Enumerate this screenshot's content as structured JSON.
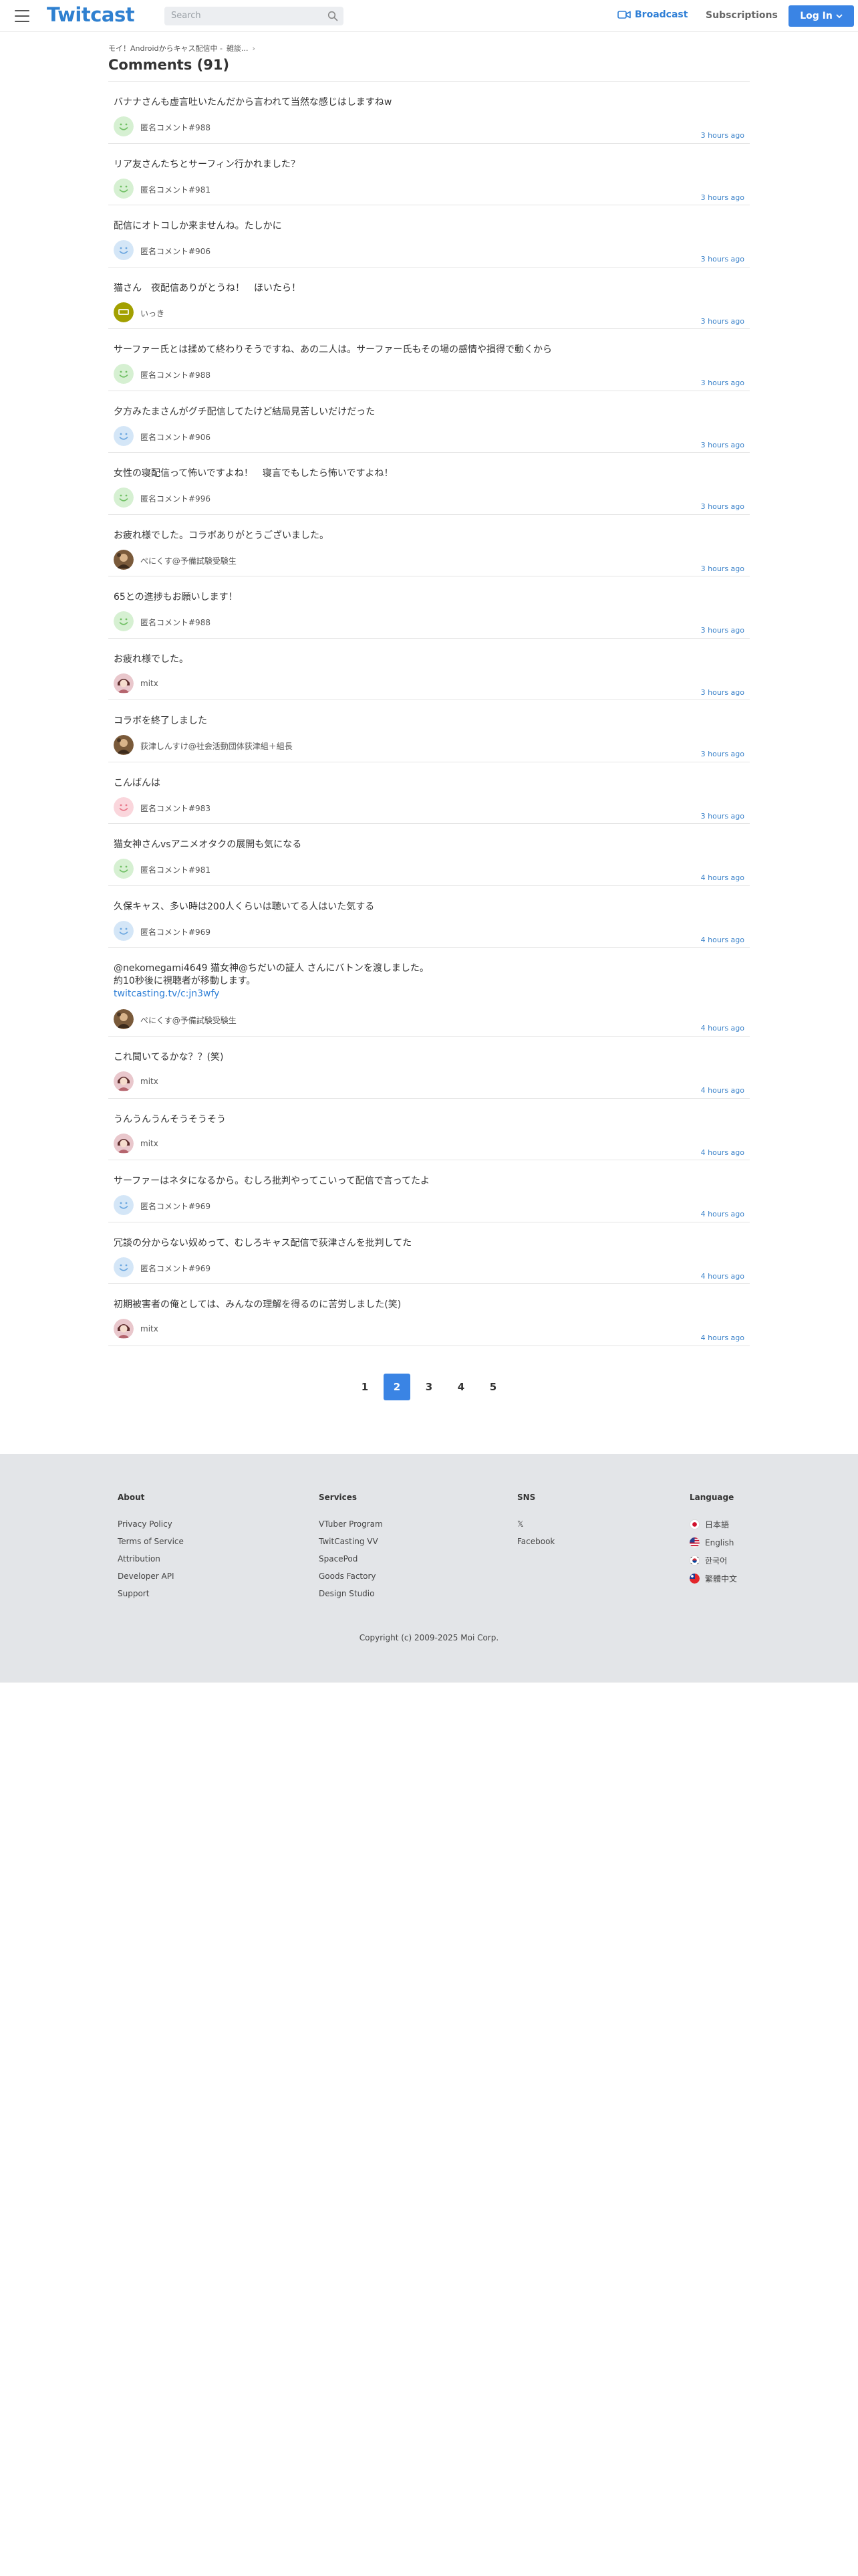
{
  "header": {
    "logo": "Twitcast",
    "search_placeholder": "Search",
    "broadcast_label": "Broadcast",
    "subscriptions_label": "Subscriptions",
    "login_label": "Log In",
    "accent_color": "#3a84e4"
  },
  "breadcrumb": [
    "モイ！Androidからキャス配信中 -",
    "雑談..."
  ],
  "page_title": "Comments (91)",
  "comments": [
    {
      "text": "バナナさんも虚言吐いたんだから言われて当然な感じはしますねw",
      "user": "匿名コメント#988",
      "time": "3 hours ago",
      "avatar": "green-smile"
    },
    {
      "text": "リア友さんたちとサーフィン行かれました？",
      "user": "匿名コメント#981",
      "time": "3 hours ago",
      "avatar": "green-smile"
    },
    {
      "text": "配信にオトコしか来ませんね。たしかに",
      "user": "匿名コメント#906",
      "time": "3 hours ago",
      "avatar": "blue-smile"
    },
    {
      "text": "猫さん　夜配信ありがとうね！　ほいたら！",
      "user": "いっき",
      "time": "3 hours ago",
      "avatar": "olive-badge"
    },
    {
      "text": "サーファー氏とは揉めて終わりそうですね、あの二人は。サーファー氏もその場の感情や損得で動くから",
      "user": "匿名コメント#988",
      "time": "3 hours ago",
      "avatar": "green-smile"
    },
    {
      "text": "夕方みたまさんがグチ配信してたけど結局見苦しいだけだった",
      "user": "匿名コメント#906",
      "time": "3 hours ago",
      "avatar": "blue-smile"
    },
    {
      "text": "女性の寝配信って怖いですよね！　寝言でもしたら怖いですよね！",
      "user": "匿名コメント#996",
      "time": "3 hours ago",
      "avatar": "green-smile"
    },
    {
      "text": "お疲れ様でした。コラボありがとうございました。",
      "user": "ぺにくす@予備試験受験生",
      "time": "3 hours ago",
      "avatar": "photo-brown"
    },
    {
      "text": "65との進捗もお願いします！",
      "user": "匿名コメント#988",
      "time": "3 hours ago",
      "avatar": "green-smile"
    },
    {
      "text": "お疲れ様でした。",
      "user": "mitx",
      "time": "3 hours ago",
      "avatar": "photo-pink"
    },
    {
      "text": "コラボを終了しました",
      "user": "荻津しんすけ@社会活動団体荻津組＋組長",
      "time": "3 hours ago",
      "avatar": "photo-brown"
    },
    {
      "text": "こんばんは",
      "user": "匿名コメント#983",
      "time": "3 hours ago",
      "avatar": "pink-smile"
    },
    {
      "text": "猫女神さんvsアニメオタクの展開も気になる",
      "user": "匿名コメント#981",
      "time": "4 hours ago",
      "avatar": "green-smile"
    },
    {
      "text": "久保キャス、多い時は200人くらいは聴いてる人はいた気する",
      "user": "匿名コメント#969",
      "time": "4 hours ago",
      "avatar": "blue-smile"
    },
    {
      "text": "@nekomegami4649 猫女神@ちだいの証人 さんにバトンを渡しました。",
      "text2": "約10秒後に視聴者が移動します。",
      "link": "twitcasting.tv/c:jn3wfy",
      "user": "ぺにくす@予備試験受験生",
      "time": "4 hours ago",
      "avatar": "photo-brown"
    },
    {
      "text": "これ聞いてるかな？？(笑)",
      "user": "mitx",
      "time": "4 hours ago",
      "avatar": "photo-pink"
    },
    {
      "text": "うんうんうんそうそうそう",
      "user": "mitx",
      "time": "4 hours ago",
      "avatar": "photo-pink"
    },
    {
      "text": "サーファーはネタになるから。むしろ批判やってこいって配信で言ってたよ",
      "user": "匿名コメント#969",
      "time": "4 hours ago",
      "avatar": "blue-smile"
    },
    {
      "text": "冗談の分からない奴めって、むしろキャス配信で荻津さんを批判してた",
      "user": "匿名コメント#969",
      "time": "4 hours ago",
      "avatar": "blue-smile"
    },
    {
      "text": "初期被害者の俺としては、みんなの理解を得るのに苦労しました(笑)",
      "user": "mitx",
      "time": "4 hours ago",
      "avatar": "photo-pink"
    }
  ],
  "pagination": {
    "pages": [
      "1",
      "2",
      "3",
      "4",
      "5"
    ],
    "active": "2"
  },
  "footer": {
    "about": {
      "title": "About",
      "links": [
        "Privacy Policy",
        "Terms of Service",
        "Attribution",
        "Developer API",
        "Support"
      ]
    },
    "services": {
      "title": "Services",
      "links": [
        "VTuber Program",
        "TwitCasting VV",
        "SpacePod",
        "Goods Factory",
        "Design Studio"
      ]
    },
    "sns": {
      "title": "SNS",
      "links": [
        "𝕏",
        "Facebook"
      ]
    },
    "language": {
      "title": "Language",
      "items": [
        {
          "label": "日本語",
          "flag": "jp"
        },
        {
          "label": "English",
          "flag": "us"
        },
        {
          "label": "한국어",
          "flag": "kr"
        },
        {
          "label": "繁體中文",
          "flag": "tw"
        }
      ]
    },
    "copyright": "Copyright (c) 2009-2025 Moi Corp."
  }
}
